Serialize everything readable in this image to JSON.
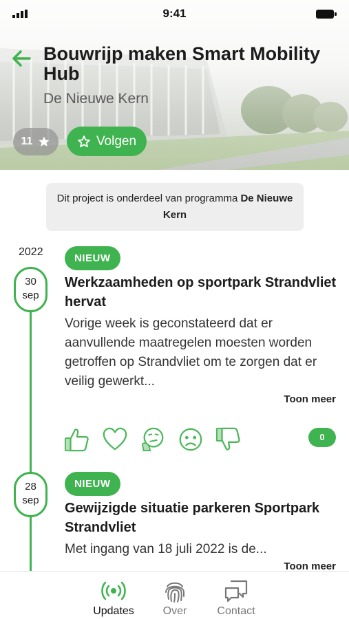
{
  "status_bar": {
    "time": "9:41"
  },
  "header": {
    "title": "Bouwrijp maken Smart Mobility Hub",
    "subtitle": "De Nieuwe Kern",
    "rating_count": "11",
    "follow_label": "Volgen"
  },
  "program_banner": {
    "prefix": "Dit project is onderdeel van programma ",
    "program_name": "De Nieuwe Kern"
  },
  "timeline": {
    "year": "2022",
    "items": [
      {
        "day": "30",
        "month": "sep",
        "badge": "NIEUW",
        "title": "Werkzaamheden op sportpark Strandvliet hervat",
        "body": "Vorige week is geconstateerd dat er aanvullende maatregelen moesten worden getroffen op Strandvliet om te zorgen dat er veilig gewerkt...",
        "show_more": "Toon meer",
        "comment_count": "0"
      },
      {
        "day": "28",
        "month": "sep",
        "badge": "NIEUW",
        "title": "Gewijzigde situatie parkeren Sportpark Strandvliet",
        "body": "Met ingang van 18 juli 2022 is de...",
        "show_more": "Toon meer"
      }
    ]
  },
  "reactions": [
    "thumbs-up-icon",
    "heart-icon",
    "thinking-icon",
    "sad-face-icon",
    "thumbs-down-icon"
  ],
  "bottom_nav": {
    "items": [
      {
        "label": "Updates",
        "icon": "broadcast-icon",
        "active": true
      },
      {
        "label": "Over",
        "icon": "fingerprint-icon",
        "active": false
      },
      {
        "label": "Contact",
        "icon": "chat-bubbles-icon",
        "active": false
      }
    ]
  },
  "colors": {
    "accent": "#3fb34f",
    "inactive": "#777777",
    "banner_bg": "#eeeeee"
  }
}
